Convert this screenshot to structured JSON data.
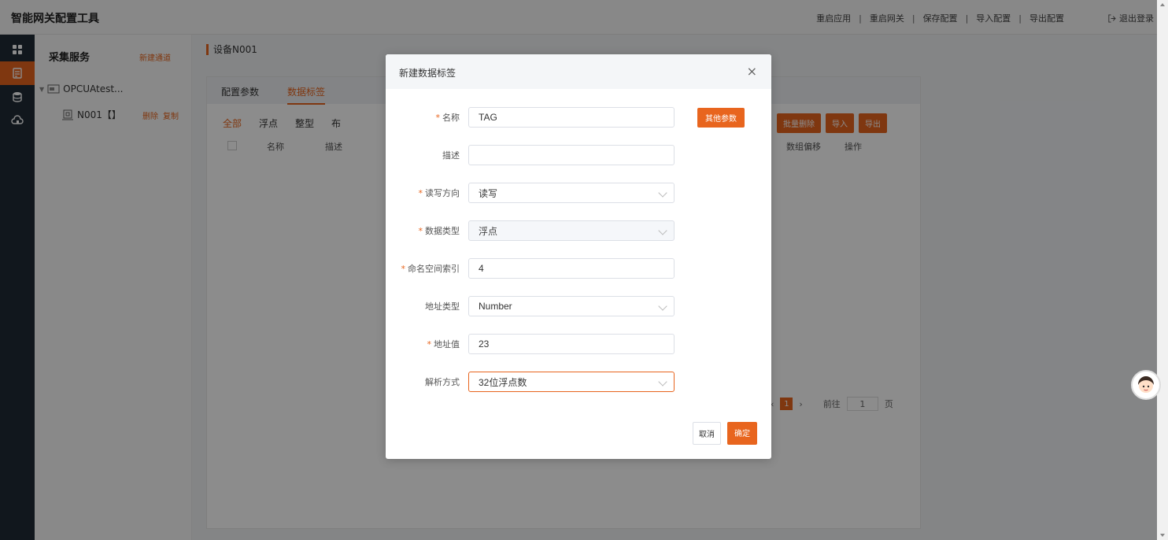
{
  "app": {
    "title": "智能网关配置工具"
  },
  "header": {
    "actions": [
      "重启应用",
      "重启网关",
      "保存配置",
      "导入配置",
      "导出配置"
    ],
    "logout": "退出登录"
  },
  "tree": {
    "title": "采集服务",
    "new_channel": "新建通道",
    "channel": "OPCUAtest...",
    "device": "N001【】",
    "delete": "删除",
    "copy": "复制"
  },
  "main": {
    "breadcrumb": "设备N001",
    "tabs": [
      "配置参数",
      "数据标签"
    ],
    "subtabs": [
      "全部",
      "浮点",
      "整型",
      "布"
    ],
    "buttons": [
      "批量删除",
      "导入",
      "导出"
    ],
    "columns": [
      "名称",
      "描述",
      "数组偏移",
      "操作"
    ],
    "pager": {
      "page": "1",
      "goto": "前往",
      "goto_value": "1",
      "page_unit": "页"
    }
  },
  "dialog": {
    "title": "新建数据标签",
    "close": "×",
    "other_params": "其他参数",
    "fields": {
      "name": {
        "label": "名称",
        "value": "TAG"
      },
      "desc": {
        "label": "描述",
        "value": ""
      },
      "rw": {
        "label": "读写方向",
        "value": "读写"
      },
      "dtype": {
        "label": "数据类型",
        "value": "浮点"
      },
      "ns": {
        "label": "命名空间索引",
        "value": "4"
      },
      "addr_type": {
        "label": "地址类型",
        "value": "Number"
      },
      "addr": {
        "label": "地址值",
        "value": "23"
      },
      "parse": {
        "label": "解析方式",
        "value": "32位浮点数"
      }
    },
    "cancel": "取消",
    "ok": "确定"
  },
  "colors": {
    "accent": "#e8651e",
    "rail": "#1f2a36"
  }
}
